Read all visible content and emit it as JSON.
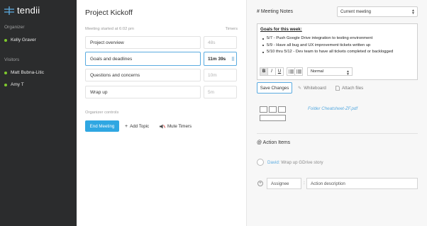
{
  "app": {
    "logo_text": "tendii"
  },
  "sidebar": {
    "organizer_label": "Organizer",
    "organizer": "Kelly Graver",
    "visitors_label": "Visitors",
    "visitors": [
      "Matt Bubna-Litic",
      "Amy T"
    ]
  },
  "meeting": {
    "title": "Project Kickoff",
    "started": "Meeting started at 6:02 pm",
    "timers_label": "Timers",
    "agenda": [
      {
        "label": "Project overview",
        "timer": "48s"
      },
      {
        "label": "Goals and deadlines",
        "timer": "11m 39s"
      },
      {
        "label": "Questions and concerns",
        "timer": "10m"
      },
      {
        "label": "Wrap up",
        "timer": "5m"
      }
    ],
    "controls_label": "Organizer controls",
    "end_button": "End Meeting",
    "add_topic": "Add Topic",
    "mute_timers": "Mute Timers"
  },
  "notes": {
    "title": "# Meeting Notes",
    "select_value": "Current meeting",
    "heading": "Goals for this week:",
    "bullets": [
      "5/7 - Push Google Drive integration to testing environment",
      "5/9 - Have all bug and UX improvement tickets written up",
      "5/10 thru 5/12 - Dev team to have all tickets completed or backlogged"
    ],
    "toolbar": {
      "bold": "B",
      "italic": "I",
      "underline": "U",
      "format_value": "Normal"
    },
    "save_button": "Save Changes",
    "whiteboard": "Whiteboard",
    "attach": "Attach files",
    "file_name": "Folder Cheatsheet-ZF.pdf"
  },
  "action_items": {
    "title": "@ Action Items",
    "items": [
      {
        "assignee": "David:",
        "text": " Wrap up GDrive story"
      }
    ],
    "assignee_placeholder": "Assignee",
    "description_placeholder": "Action description"
  },
  "colors": {
    "accent": "#2fa7e2",
    "sidebar_bg": "#2b2c2d",
    "online": "#7ec92d"
  }
}
